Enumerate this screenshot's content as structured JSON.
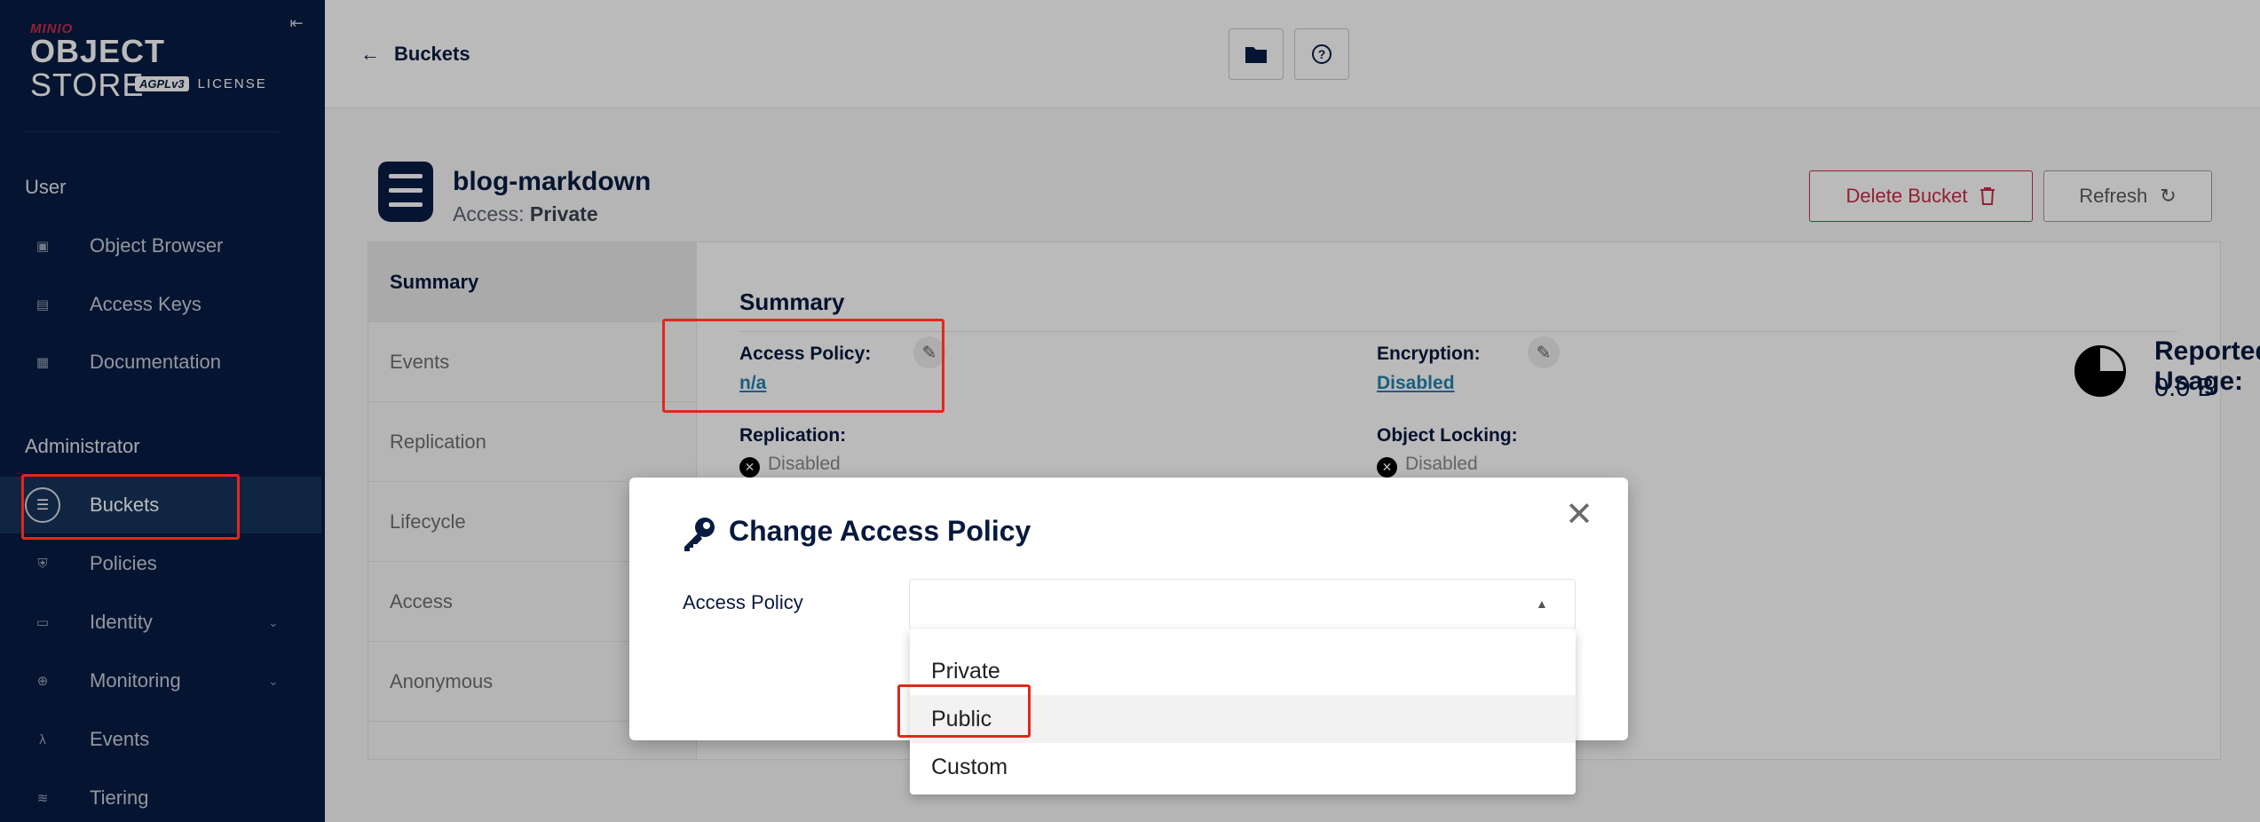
{
  "sidebar": {
    "logo_brand": "MINIO",
    "logo_product_bold": "OBJECT",
    "logo_product_light": " STORE",
    "logo_badge": "AGPLv3",
    "logo_license": "LICENSE",
    "section_user": "User",
    "section_admin": "Administrator",
    "items": [
      {
        "label": "Object Browser",
        "icon": "object-browser-icon"
      },
      {
        "label": "Access Keys",
        "icon": "access-keys-icon"
      },
      {
        "label": "Documentation",
        "icon": "documentation-icon"
      },
      {
        "label": "Buckets",
        "icon": "buckets-icon",
        "active": true
      },
      {
        "label": "Policies",
        "icon": "policies-icon"
      },
      {
        "label": "Identity",
        "icon": "identity-icon",
        "expandable": true
      },
      {
        "label": "Monitoring",
        "icon": "monitoring-icon",
        "expandable": true
      },
      {
        "label": "Events",
        "icon": "lambda-icon"
      },
      {
        "label": "Tiering",
        "icon": "tiering-icon"
      }
    ]
  },
  "header": {
    "back_label": "Buckets"
  },
  "bucket": {
    "name": "blog-markdown",
    "access_prefix": "Access: ",
    "access_value": "Private",
    "delete_label": "Delete Bucket",
    "refresh_label": "Refresh"
  },
  "tabs": [
    "Summary",
    "Events",
    "Replication",
    "Lifecycle",
    "Access",
    "Anonymous"
  ],
  "summary": {
    "title": "Summary",
    "access_policy_label": "Access Policy:",
    "access_policy_value": "n/a",
    "encryption_label": "Encryption:",
    "encryption_value": "Disabled",
    "replication_label": "Replication:",
    "replication_value": "Disabled",
    "object_locking_label": "Object Locking:",
    "object_locking_value": "Disabled",
    "reported_usage_label": "Reported Usage:",
    "reported_usage_value": "0.0 B"
  },
  "modal": {
    "title": "Change Access Policy",
    "field_label": "Access Policy",
    "selected_value": "",
    "options": [
      "Private",
      "Public",
      "Custom"
    ],
    "hovered_option": "Public"
  },
  "colors": {
    "sidebar_bg": "#081c42",
    "accent_red": "#c72c48",
    "link_blue": "#2781b0",
    "highlight_red": "#e3261d"
  }
}
